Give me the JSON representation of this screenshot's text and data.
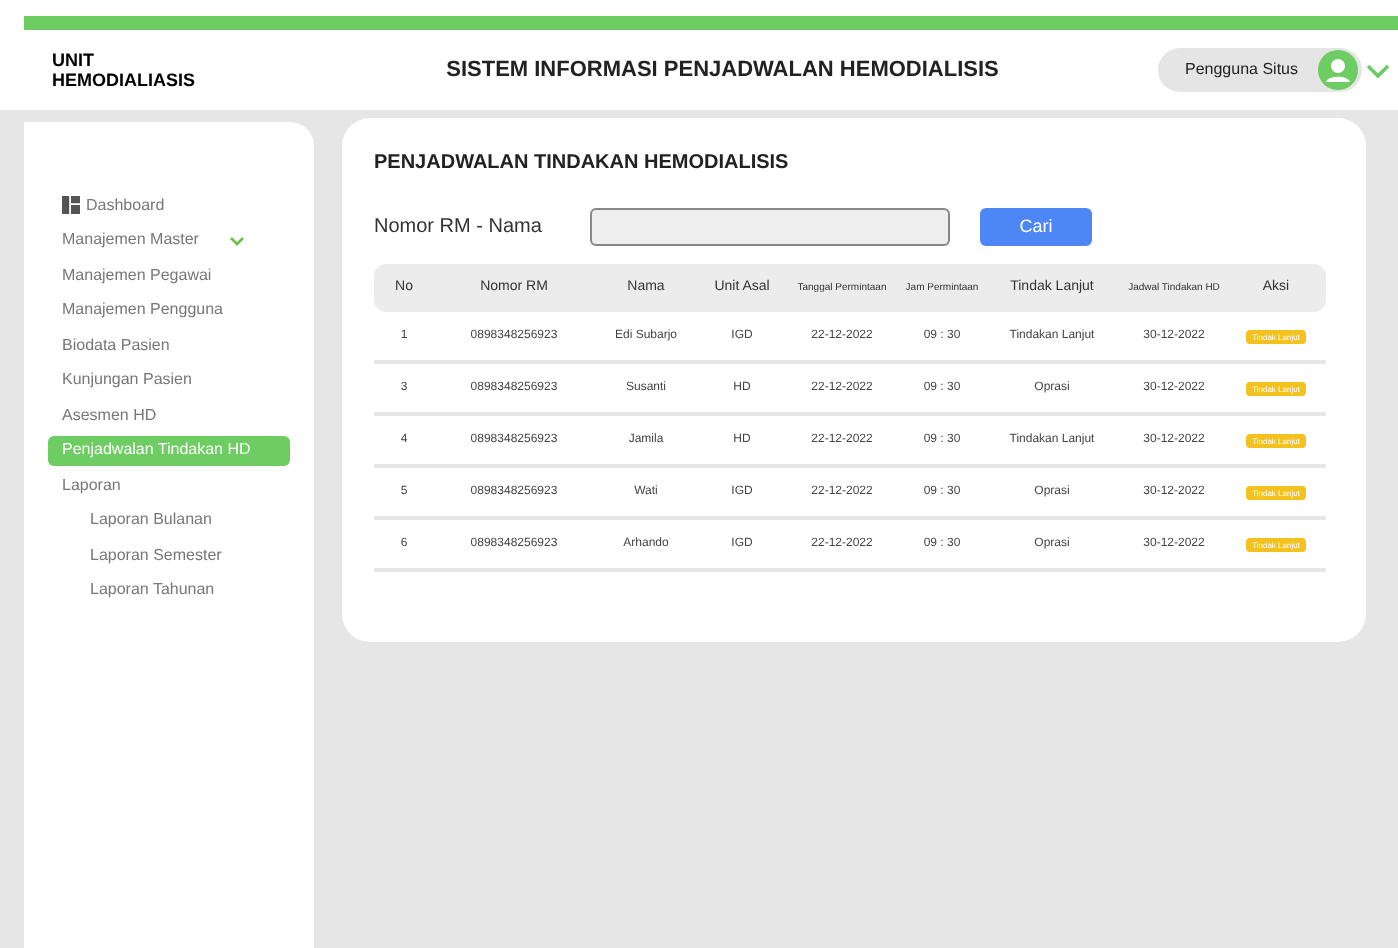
{
  "header": {
    "unit": "UNIT HEMODIALIASIS",
    "title": "SISTEM INFORMASI PENJADWALAN HEMODIALISIS",
    "user": "Pengguna Situs"
  },
  "sidebar": {
    "items": [
      {
        "label": "Dashboard",
        "kind": "dashboard",
        "selected": false
      },
      {
        "label": "Manajemen Master",
        "kind": "group",
        "expanded": true,
        "selected": false
      },
      {
        "label": "Manajemen Pegawai",
        "kind": "link",
        "selected": false
      },
      {
        "label": "Manajemen Pengguna",
        "kind": "link",
        "selected": false
      },
      {
        "label": "Biodata Pasien",
        "kind": "link",
        "selected": false
      },
      {
        "label": "Kunjungan Pasien",
        "kind": "link",
        "selected": false
      },
      {
        "label": "Asesmen HD",
        "kind": "link",
        "selected": false
      },
      {
        "label": "Penjadwalan Tindakan HD",
        "kind": "link",
        "selected": true
      },
      {
        "label": "Laporan",
        "kind": "link",
        "selected": false,
        "children": [
          {
            "label": "Laporan Bulanan",
            "selected": false
          },
          {
            "label": "Laporan Semester",
            "selected": false
          },
          {
            "label": "Laporan Tahunan",
            "selected": false
          }
        ]
      }
    ]
  },
  "main": {
    "title": "PENJADWALAN TINDAKAN HEMODIALISIS",
    "search": {
      "label": "Nomor RM - Nama",
      "button": "Cari"
    },
    "table": {
      "columns": [
        "No",
        "Nomor RM",
        "Nama",
        "Unit Asal",
        "Tanggal Permintaan",
        "Jam Permintaan",
        "Tindak Lanjut",
        "Jadwal Tindakan HD",
        "Aksi"
      ],
      "rows": [
        [
          "1",
          "0898348256923",
          "Edi Subarjo",
          "IGD",
          "22-12-2022",
          "09 : 30",
          "Tindakan Lanjut",
          "30-12-2022",
          "Tindak Lanjut"
        ],
        [
          "3",
          "0898348256923",
          "Susanti",
          "HD",
          "22-12-2022",
          "09 : 30",
          "Oprasi",
          "30-12-2022",
          "Tindak Lanjut"
        ],
        [
          "4",
          "0898348256923",
          "Jamila",
          "HD",
          "22-12-2022",
          "09 : 30",
          "Tindakan Lanjut",
          "30-12-2022",
          "Tindak Lanjut"
        ],
        [
          "5",
          "0898348256923",
          "Wati",
          "IGD",
          "22-12-2022",
          "09 : 30",
          "Oprasi",
          "30-12-2022",
          "Tindak Lanjut"
        ],
        [
          "6",
          "0898348256923",
          "Arhando",
          "IGD",
          "22-12-2022",
          "09 : 30",
          "Oprasi",
          "30-12-2022",
          "Tindak Lanjut"
        ]
      ]
    }
  }
}
